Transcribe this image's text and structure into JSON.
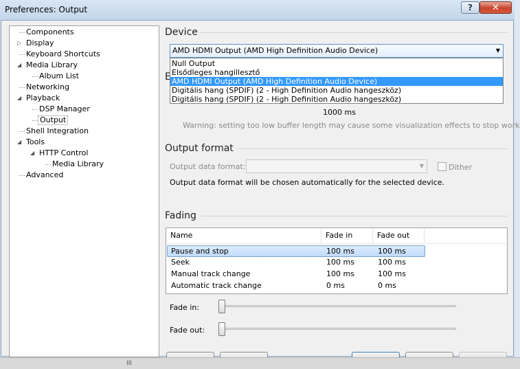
{
  "window": {
    "title": "Preferences: Output",
    "help_label": "?",
    "close_label": "✕"
  },
  "tree": {
    "items": [
      {
        "label": "Components"
      },
      {
        "label": "Display"
      },
      {
        "label": "Keyboard Shortcuts"
      },
      {
        "label": "Media Library"
      },
      {
        "label": "Album List"
      },
      {
        "label": "Networking"
      },
      {
        "label": "Playback"
      },
      {
        "label": "DSP Manager"
      },
      {
        "label": "Output"
      },
      {
        "label": "Shell Integration"
      },
      {
        "label": "Tools"
      },
      {
        "label": "HTTP Control"
      },
      {
        "label": "Media Library"
      },
      {
        "label": "Advanced"
      }
    ],
    "selected": "Output"
  },
  "device": {
    "section_title": "Device",
    "selected_value": "AMD HDMI Output (AMD High Definition Audio Device)",
    "hidden_section_initial": "E",
    "options": [
      "Null Output",
      "Elsődleges hangillesztő",
      "AMD HDMI Output (AMD High Definition Audio Device)",
      "Digitális hang (SPDIF) (2 - High Definition Audio hangeszköz)",
      "Digitális hang (SPDIF) (2 - High Definition Audio hangeszköz)"
    ],
    "highlighted_index": 2,
    "buffer_value": "1000 ms",
    "buffer_warning": "Warning: setting too low buffer length may cause some visualization effects to stop working."
  },
  "output_format": {
    "section_title": "Output format",
    "format_label": "Output data format:",
    "format_value": "",
    "dither_label": "Dither",
    "dither_checked": false,
    "note": "Output data format will be chosen automatically for the selected device."
  },
  "fading": {
    "section_title": "Fading",
    "columns": [
      "Name",
      "Fade in",
      "Fade out"
    ],
    "rows": [
      [
        "Pause and stop",
        "100 ms",
        "100 ms"
      ],
      [
        "Seek",
        "100 ms",
        "100 ms"
      ],
      [
        "Manual track change",
        "100 ms",
        "100 ms"
      ],
      [
        "Automatic track change",
        "0 ms",
        "0 ms"
      ]
    ],
    "selected_row": 0,
    "fade_in_label": "Fade in:",
    "fade_out_label": "Fade out:",
    "fade_in_level": 0,
    "fade_out_level": 0
  },
  "statusbar": {
    "grip": "III"
  }
}
